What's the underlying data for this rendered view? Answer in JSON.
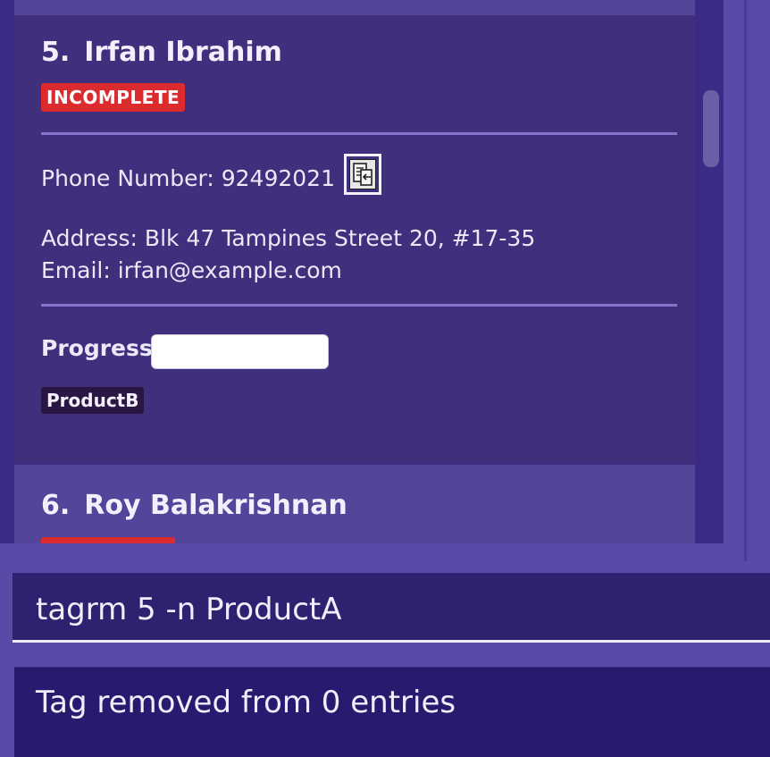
{
  "person_list": {
    "selected_card": {
      "index": "5.",
      "name": "Irfan Ibrahim",
      "status": "INCOMPLETE",
      "phone": "Phone Number: 92492021",
      "address": "Address: Blk 47 Tampines Street 20, #17-35",
      "email": "Email: irfan@example.com",
      "progress_label": "Progress:",
      "progress_value": 0,
      "tags": [
        "ProductB"
      ]
    },
    "next_card": {
      "index": "6.",
      "name": "Roy Balakrishnan"
    }
  },
  "command_box": {
    "value": "tagrm 5 -n ProductA"
  },
  "result_display": {
    "message": "Tag removed from 0 entries"
  },
  "colors": {
    "background": "#5a4aa8",
    "card_selected": "#3f2f7d",
    "card_unselected": "#54449a",
    "status_incomplete": "#dc2b2f",
    "tag": "#2a1642",
    "command_box": "#2f2070",
    "result_box": "#281a6e"
  },
  "icons": {
    "copy_phone": "copy-icon"
  }
}
